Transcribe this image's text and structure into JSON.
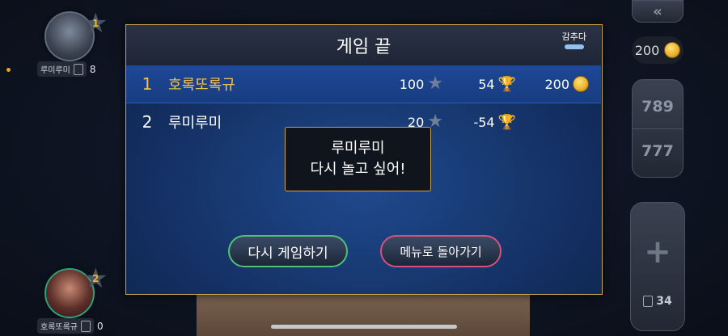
{
  "players": [
    {
      "name": "루미루미",
      "rank": "1",
      "cards": "8"
    },
    {
      "name": "호록또록규",
      "rank": "2",
      "cards": "0"
    }
  ],
  "sidebar": {
    "coins": "200",
    "score_top": "789",
    "score_bottom": "777",
    "add_symbol": "+",
    "deck_count": "34",
    "collapse_symbol": "«"
  },
  "dialog": {
    "title": "게임 끝",
    "hide_label": "감추다",
    "results": [
      {
        "rank": "1",
        "name": "호록또록규",
        "xp": "100",
        "trophies": "54",
        "gold": "200"
      },
      {
        "rank": "2",
        "name": "루미루미",
        "xp": "20",
        "trophies": "-54",
        "gold": ""
      }
    ],
    "xp_icon_label": "xp",
    "bubble_line1": "루미루미",
    "bubble_line2": "다시 놀고 싶어!",
    "play_again_label": "다시 게임하기",
    "back_to_menu_label": "메뉴로 돌아가기"
  },
  "colors": {
    "gold_accent": "#c9a552",
    "play_again_border": "#4fc27a",
    "menu_border": "#d7517e"
  }
}
